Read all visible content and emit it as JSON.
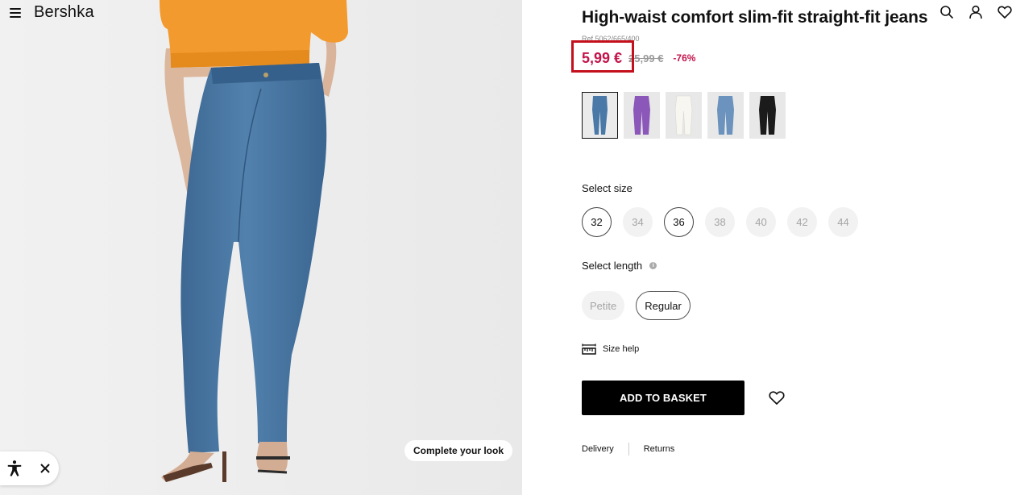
{
  "nav": {
    "brand": "Bershka",
    "menu_icon": "menu-icon"
  },
  "hero": {
    "complete_look_label": "Complete your look"
  },
  "accessibility": {
    "toggle_icon": "accessibility-icon",
    "close_icon": "close-icon"
  },
  "header_icons": [
    "search-icon",
    "user-icon",
    "heart-icon"
  ],
  "product": {
    "title": "High-waist comfort slim-fit straight-fit jeans",
    "ref": "Ref 5062/665/400",
    "price": {
      "current": "5,99 €",
      "original": "25,99 €",
      "discount": "-76%"
    },
    "colors": [
      {
        "name": "mid-blue",
        "hex": "#4a79a8",
        "selected": true
      },
      {
        "name": "purple",
        "hex": "#8b57b8",
        "selected": false
      },
      {
        "name": "white",
        "hex": "#f0efe9",
        "selected": false
      },
      {
        "name": "light-blue",
        "hex": "#6b93bd",
        "selected": false
      },
      {
        "name": "black",
        "hex": "#1b1b1b",
        "selected": false
      }
    ],
    "size_label": "Select size",
    "sizes": [
      {
        "label": "32",
        "available": true
      },
      {
        "label": "34",
        "available": false
      },
      {
        "label": "36",
        "available": true
      },
      {
        "label": "38",
        "available": false
      },
      {
        "label": "40",
        "available": false
      },
      {
        "label": "42",
        "available": false
      },
      {
        "label": "44",
        "available": false
      }
    ],
    "length_label": "Select length",
    "lengths": [
      {
        "label": "Petite",
        "available": false
      },
      {
        "label": "Regular",
        "available": true
      }
    ],
    "size_help": "Size help",
    "add_to_basket": "ADD TO BASKET",
    "delivery": "Delivery",
    "returns": "Returns"
  },
  "colors": {
    "price": "#c4144b",
    "highlight": "#c40f1c",
    "button": "#000000"
  }
}
